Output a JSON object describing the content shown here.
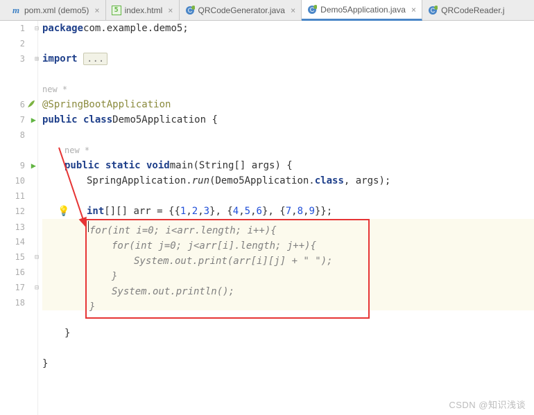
{
  "tabs": [
    {
      "icon": "m",
      "iconColor": "#3b7fc4",
      "label": "pom.xml (demo5)",
      "active": false
    },
    {
      "icon": "h",
      "iconColor": "#62b543",
      "label": "index.html",
      "active": false
    },
    {
      "icon": "C",
      "iconColor": "#3b7fc4",
      "label": "QRCodeGenerator.java",
      "active": false
    },
    {
      "icon": "C",
      "iconColor": "#3b7fc4",
      "label": "Demo5Application.java",
      "active": true
    },
    {
      "icon": "C",
      "iconColor": "#3b7fc4",
      "label": "QRCodeReader.j",
      "active": false
    }
  ],
  "gutter": [
    "1",
    "2",
    "3",
    "",
    "",
    "6",
    "7",
    "8",
    "",
    "9",
    "10",
    "11",
    "12",
    "13",
    "14",
    "15",
    "16",
    "17",
    "18"
  ],
  "code": {
    "l1_kw": "package",
    "l1_pkg": " com.example.demo5;",
    "l3_kw": "import",
    "l3_fold": "...",
    "new": "new *",
    "l6_ann": "@SpringBootApplication",
    "l7_a": "public class",
    "l7_b": " Demo5Application {",
    "l9_a": "public static void",
    "l9_b": " main",
    "l9_c": "(String[] args) {",
    "l10_a": "SpringApplication.",
    "l10_b": "run",
    "l10_c": "(Demo5Application.",
    "l10_cls": "class",
    "l10_d": ", args);",
    "l12_a": "int",
    "l12_b": "[][] arr = {{",
    "l12_n1": "1",
    "l12_n2": "2",
    "l12_n3": "3",
    "l12_c1": "}, {",
    "l12_n4": "4",
    "l12_n5": "5",
    "l12_n6": "6",
    "l12_c2": "}, {",
    "l12_n7": "7",
    "l12_n8": "8",
    "l12_n9": "9",
    "l12_c3": "}};",
    "l15": "}",
    "l17": "}"
  },
  "template": {
    "r1": "for(int i=0; i<arr.length; i++){",
    "r2": "for(int j=0; j<arr[i].length; j++){",
    "r3": "System.out.print(arr[i][j] + \" \");",
    "r4": "}",
    "r5": "System.out.println();",
    "r6": "}"
  },
  "watermark": "CSDN @知识浅谈"
}
